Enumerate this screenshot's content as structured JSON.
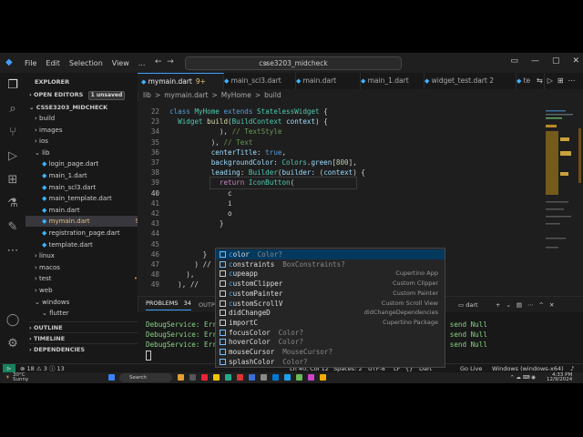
{
  "titlebar": {
    "menus": [
      "File",
      "Edit",
      "Selection",
      "View",
      "..."
    ],
    "search": "csse3203_midcheck"
  },
  "explorer": {
    "title": "EXPLORER",
    "open_editors": "OPEN EDITORS",
    "unsaved": "1 unsaved",
    "project": "CSSE3203_MIDCHECK",
    "tree": [
      {
        "label": "build",
        "indent": 1,
        "kind": "folder-closed"
      },
      {
        "label": "images",
        "indent": 1,
        "kind": "folder-closed"
      },
      {
        "label": "ios",
        "indent": 1,
        "kind": "folder-closed"
      },
      {
        "label": "lib",
        "indent": 1,
        "kind": "folder-open"
      },
      {
        "label": "login_page.dart",
        "indent": 2,
        "kind": "file"
      },
      {
        "label": "main_1.dart",
        "indent": 2,
        "kind": "file"
      },
      {
        "label": "main_scl3.dart",
        "indent": 2,
        "kind": "file"
      },
      {
        "label": "main_template.dart",
        "indent": 2,
        "kind": "file"
      },
      {
        "label": "main.dart",
        "indent": 2,
        "kind": "file"
      },
      {
        "label": "mymain.dart",
        "indent": 2,
        "kind": "file",
        "badge": "9+",
        "selected": true
      },
      {
        "label": "registration_page.dart",
        "indent": 2,
        "kind": "file"
      },
      {
        "label": "template.dart",
        "indent": 2,
        "kind": "file"
      },
      {
        "label": "linux",
        "indent": 1,
        "kind": "folder-closed"
      },
      {
        "label": "macos",
        "indent": 1,
        "kind": "folder-closed"
      },
      {
        "label": "test",
        "indent": 1,
        "kind": "folder-closed",
        "dot": "•"
      },
      {
        "label": "web",
        "indent": 1,
        "kind": "folder-closed"
      },
      {
        "label": "windows",
        "indent": 1,
        "kind": "folder-open"
      },
      {
        "label": "flutter",
        "indent": 2,
        "kind": "folder-open"
      }
    ],
    "outline": "OUTLINE",
    "timeline": "TIMELINE",
    "dependencies": "DEPENDENCIES"
  },
  "tabs": [
    {
      "label": "mymain.dart",
      "extra": "9+",
      "active": true
    },
    {
      "label": "main_scl3.dart"
    },
    {
      "label": "main.dart"
    },
    {
      "label": "main_1.dart"
    },
    {
      "label": "widget_test.dart 2"
    },
    {
      "label": "te"
    }
  ],
  "breadcrumbs": [
    "lib",
    ">",
    "mymain.dart",
    ">",
    "MyHome",
    ">",
    "build"
  ],
  "editor": {
    "lines": [
      {
        "n": "22",
        "html": "<span class=\"kw\">class</span> <span class=\"ty\">MyHome</span> <span class=\"kw\">extends</span> <span class=\"ty\">StatelessWidget</span> {"
      },
      {
        "n": "23",
        "html": "  <span class=\"ty\">Widget</span> <span class=\"fn\">build</span>(<span class=\"ty\">BuildContext</span> <span class=\"pa\">context</span>) {"
      },
      {
        "n": "34",
        "html": "            ), <span class=\"cm\">// TextStyle</span>"
      },
      {
        "n": "35",
        "html": "          ), <span class=\"cm\">// Text</span>"
      },
      {
        "n": "36",
        "html": "          <span class=\"pa\">centerTitle</span>: <span class=\"kw\">true</span>,"
      },
      {
        "n": "37",
        "html": "          <span class=\"pa\">backgroundColor</span>: <span class=\"ty\">Colors</span>.<span class=\"pa\">green</span>[<span class=\"nu\">800</span>],"
      },
      {
        "n": "38",
        "html": "          <span class=\"pa\">leading</span>: <span class=\"ty\">Builder</span>(<span class=\"pa\">builder</span>: (<span class=\"pa\">context</span>) {"
      },
      {
        "n": "39",
        "html": "            <span class=\"ctl\">return</span> <span class=\"ty\">IconButton</span>("
      },
      {
        "n": "40",
        "html": "              c"
      },
      {
        "n": "41",
        "html": "              i"
      },
      {
        "n": "42",
        "html": "              o"
      },
      {
        "n": "43",
        "html": "            }"
      },
      {
        "n": "44",
        "html": ""
      },
      {
        "n": "45",
        "html": ""
      },
      {
        "n": "46",
        "html": "        }"
      },
      {
        "n": "47",
        "html": "      ) //"
      },
      {
        "n": "48",
        "html": "    ),"
      },
      {
        "n": "49",
        "html": "  ), //"
      }
    ]
  },
  "suggest": [
    {
      "name": "color",
      "match": "c",
      "type": "Color?",
      "detail": "",
      "kind": "prop",
      "selected": true
    },
    {
      "name": "constraints",
      "match": "c",
      "type": "BoxConstraints?",
      "detail": "",
      "kind": "prop"
    },
    {
      "name": "cupeapp",
      "match": "c",
      "type": "",
      "detail": "Cupertino App",
      "kind": "cls"
    },
    {
      "name": "customClipper",
      "match": "c",
      "type": "",
      "detail": "Custom Clipper",
      "kind": "cls"
    },
    {
      "name": "customPainter",
      "match": "c",
      "type": "",
      "detail": "Custom Painter",
      "kind": "cls"
    },
    {
      "name": "customScrollV",
      "match": "c",
      "type": "",
      "detail": "Custom Scroll View",
      "kind": "cls"
    },
    {
      "name": "didChangeD",
      "match": "",
      "type": "",
      "detail": "didChangeDependencies",
      "kind": "cls"
    },
    {
      "name": "importC",
      "match": "",
      "type": "",
      "detail": "Cupertino Package",
      "kind": "cls"
    },
    {
      "name": "focusColor",
      "match": "",
      "type": "Color?",
      "detail": "",
      "kind": "prop"
    },
    {
      "name": "hoverColor",
      "match": "",
      "type": "Color?",
      "detail": "",
      "kind": "prop"
    },
    {
      "name": "mouseCursor",
      "match": "",
      "type": "MouseCursor?",
      "detail": "",
      "kind": "prop"
    },
    {
      "name": "splashColor",
      "match": "",
      "type": "Color?",
      "detail": "",
      "kind": "prop"
    }
  ],
  "panel": {
    "problems_label": "PROBLEMS",
    "problems_count": "34",
    "output_label": "OUTPU",
    "terminal_name": "dart",
    "lines": [
      "DebugService: Error serving requestsError: Unsupported operation: Cannot send Null",
      "DebugService: Error serving requestsError: Unsupported operation: Cannot send Null",
      "DebugService: Error serving requestsError: Unsupported operation: Cannot send Null"
    ]
  },
  "statusbar": {
    "left": "⊗ 18 ⚠ 3 ⓘ 13",
    "pos": "Ln 40, Col 12",
    "spaces": "Spaces: 2",
    "encoding": "UTF-8",
    "eol": "LF",
    "braces": "{}",
    "lang": "Dart",
    "golive": "Go Live",
    "device": "Windows (windows-x64)"
  },
  "taskbar": {
    "weather": "30°C",
    "weather_sub": "Sunny",
    "search": "Search",
    "time": "4:33 PM",
    "date": "12/9/2024"
  },
  "colors": {
    "accent": "#3ea1ff",
    "editor_bg": "#1e1e1e",
    "terminal_text": "#89d185"
  }
}
